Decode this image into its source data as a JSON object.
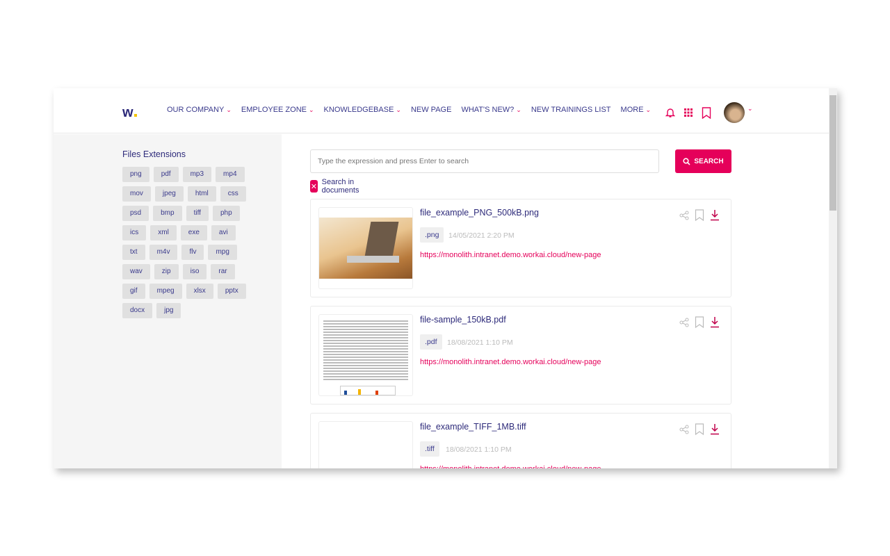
{
  "header": {
    "logo": "w",
    "nav": [
      {
        "label": "OUR COMPANY",
        "dropdown": true
      },
      {
        "label": "EMPLOYEE ZONE",
        "dropdown": true
      },
      {
        "label": "KNOWLEDGEBASE",
        "dropdown": true
      },
      {
        "label": "NEW PAGE",
        "dropdown": false
      },
      {
        "label": "WHAT'S NEW?",
        "dropdown": true
      },
      {
        "label": "NEW TRAININGS LIST",
        "dropdown": false
      },
      {
        "label": "MORE",
        "dropdown": true
      }
    ]
  },
  "sidebar": {
    "title": "Files Extensions",
    "tags": [
      "png",
      "pdf",
      "mp3",
      "mp4",
      "mov",
      "jpeg",
      "html",
      "css",
      "psd",
      "bmp",
      "tiff",
      "php",
      "ics",
      "xml",
      "exe",
      "avi",
      "txt",
      "m4v",
      "flv",
      "mpg",
      "wav",
      "zip",
      "iso",
      "rar",
      "gif",
      "mpeg",
      "xlsx",
      "pptx",
      "docx",
      "jpg"
    ]
  },
  "search": {
    "placeholder": "Type the expression and press Enter to search",
    "button": "SEARCH",
    "checkbox_label": "Search in documents",
    "checkbox_checked": true
  },
  "results": [
    {
      "title": "file_example_PNG_500kB.png",
      "ext": ".png",
      "date": "14/05/2021 2:20 PM",
      "link": "https://monolith.intranet.demo.workai.cloud/new-page"
    },
    {
      "title": "file-sample_150kB.pdf",
      "ext": ".pdf",
      "date": "18/08/2021 1:10 PM",
      "link": "https://monolith.intranet.demo.workai.cloud/new-page"
    },
    {
      "title": "file_example_TIFF_1MB.tiff",
      "ext": ".tiff",
      "date": "18/08/2021 1:10 PM",
      "link": "https://monolith.intranet.demo.workai.cloud/new-page"
    }
  ],
  "colors": {
    "accent": "#e5005a",
    "navy": "#2d2a7a"
  }
}
